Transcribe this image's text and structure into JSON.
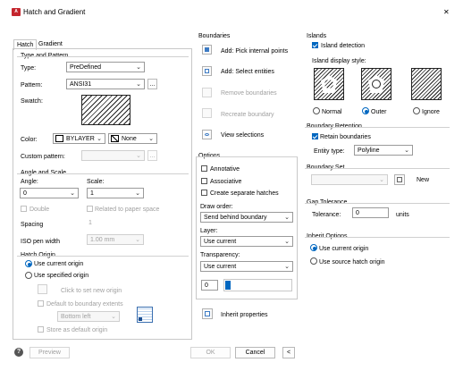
{
  "window": {
    "title": "Hatch and Gradient",
    "close": "✕"
  },
  "tabs": [
    "Hatch",
    "Gradient"
  ],
  "type_pattern": {
    "heading": "Type and Pattern",
    "type_label": "Type:",
    "type_value": "PreDefined",
    "pattern_label": "Pattern:",
    "pattern_value": "ANSI31",
    "browse": "...",
    "swatch_label": "Swatch:",
    "color_label": "Color:",
    "color_value": "BYLAYER",
    "bg_value": "None",
    "custom_label": "Custom pattern:",
    "custom_browse": "..."
  },
  "angle_scale": {
    "heading": "Angle and Scale",
    "angle_label": "Angle:",
    "angle_value": "0",
    "scale_label": "Scale:",
    "scale_value": "1",
    "double_label": "Double",
    "relative_label": "Related to paper space",
    "spacing_label": "Spacing",
    "spacing_value": "1",
    "iso_label": "ISO pen width",
    "iso_value": "1.00 mm"
  },
  "hatch_origin": {
    "heading": "Hatch Origin",
    "use_current": "Use current origin",
    "use_specified": "Use specified origin",
    "click_set": "Click to set new origin",
    "default_extents": "Default to boundary extents",
    "position_value": "Bottom left",
    "store_default": "Store as default origin"
  },
  "boundaries": {
    "heading": "Boundaries",
    "add_pick": "Add: Pick internal points",
    "add_select": "Add: Select entities",
    "remove": "Remove boundaries",
    "recreate": "Recreate boundary",
    "view": "View selections"
  },
  "options": {
    "heading": "Options",
    "annotative": "Annotative",
    "associative": "Associative",
    "separate": "Create separate hatches",
    "draw_order_label": "Draw order:",
    "draw_order_value": "Send behind boundary",
    "layer_label": "Layer:",
    "layer_value": "Use current",
    "transparency_label": "Transparency:",
    "transparency_value": "Use current",
    "transparency_number": "0"
  },
  "inherit_props": "Inherit properties",
  "islands": {
    "heading": "Islands",
    "detection": "Island detection",
    "display_label": "Island display style:",
    "normal": "Normal",
    "outer": "Outer",
    "ignore": "Ignore"
  },
  "boundary_retention": {
    "heading": "Boundary Retention",
    "retain": "Retain boundaries",
    "entity_label": "Entity type:",
    "entity_value": "Polyline"
  },
  "boundary_set": {
    "heading": "Boundary Set",
    "new": "New"
  },
  "gap": {
    "heading": "Gap Tolerance",
    "label": "Tolerance:",
    "value": "0",
    "units": "units"
  },
  "inherit_options": {
    "heading": "Inherit Options",
    "use_current": "Use current origin",
    "use_source": "Use source hatch origin"
  },
  "footer": {
    "help": "?",
    "preview": "Preview",
    "ok": "OK",
    "cancel": "Cancel",
    "more": "<"
  },
  "colors": {
    "accent": "#0067c0",
    "title_icon": "#c4262e"
  }
}
